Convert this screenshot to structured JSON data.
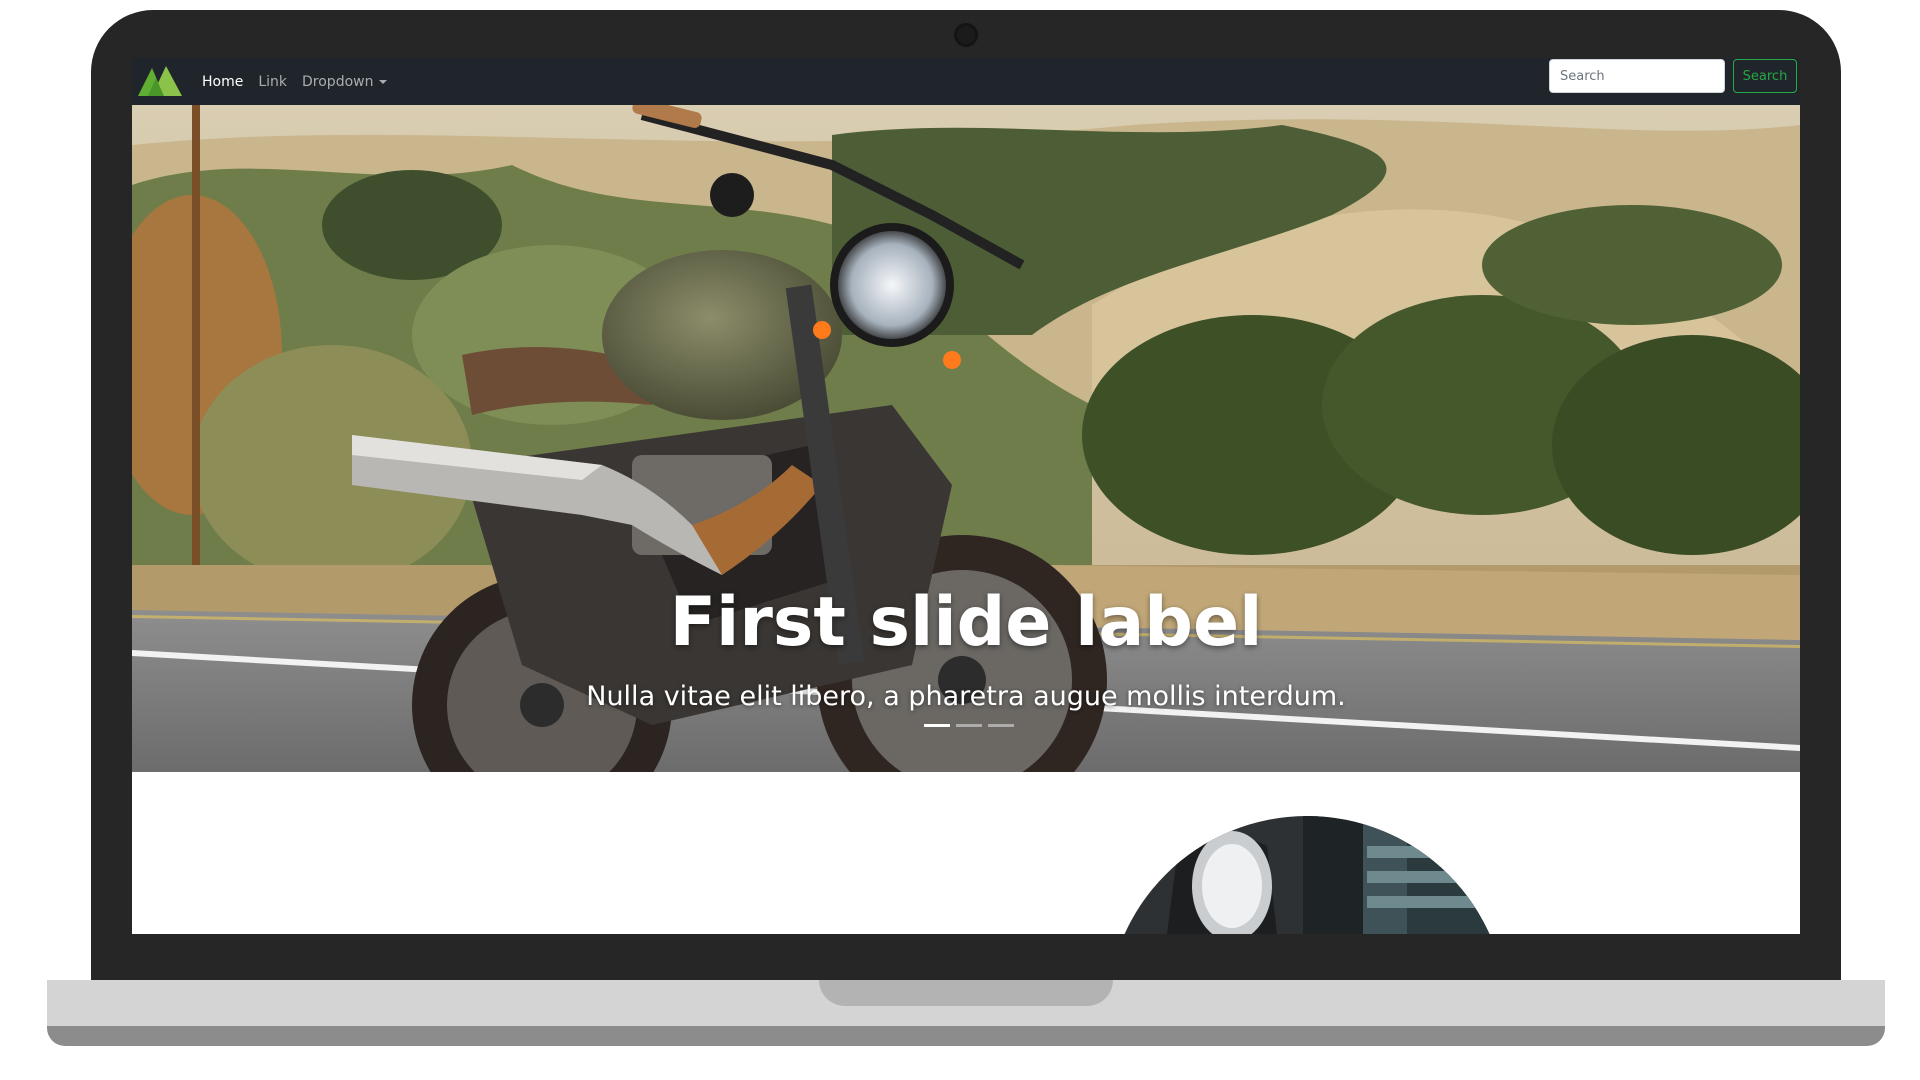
{
  "navbar": {
    "brand_icon": "mountain-logo-icon",
    "links": [
      {
        "label": "Home",
        "active": true
      },
      {
        "label": "Link",
        "active": false
      },
      {
        "label": "Dropdown",
        "active": false
      }
    ],
    "search": {
      "placeholder": "Search",
      "button_label": "Search"
    }
  },
  "carousel": {
    "slide_title": "First slide label",
    "slide_text": "Nulla vitae elit libero, a pharetra augue mollis interdum.",
    "indicator_count": 3,
    "active_index": 0
  },
  "colors": {
    "navbar_bg": "#20252b",
    "accent_green": "#28a745",
    "laptop_frame": "#262626"
  }
}
